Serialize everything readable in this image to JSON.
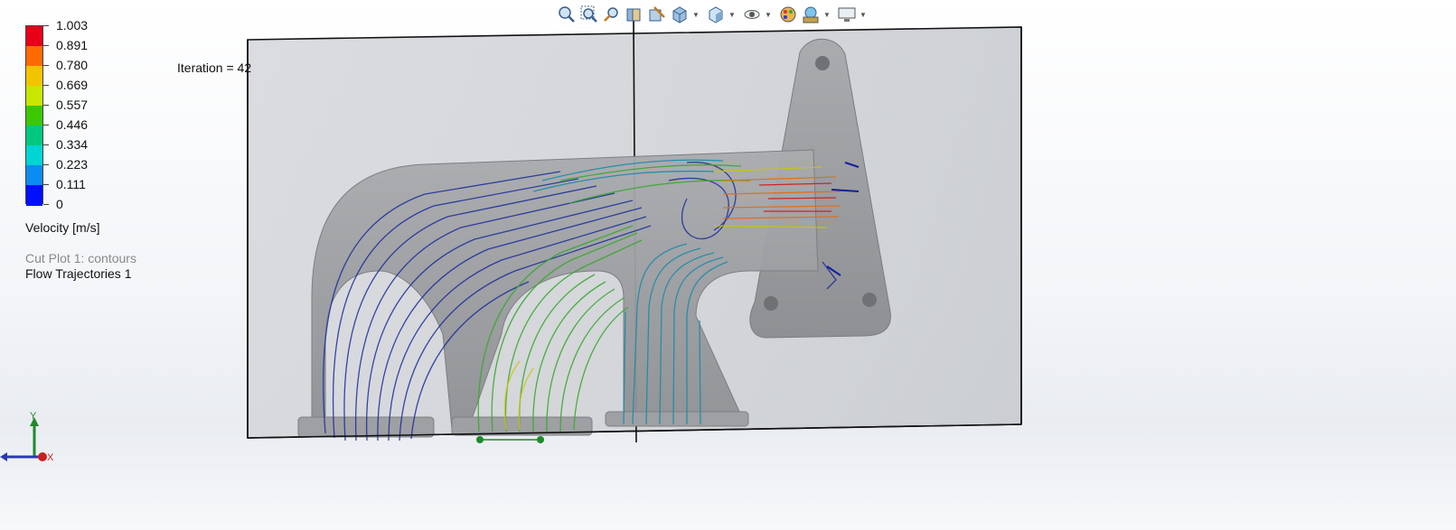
{
  "legend": {
    "ticks": [
      "1.003",
      "0.891",
      "0.780",
      "0.669",
      "0.557",
      "0.446",
      "0.334",
      "0.223",
      "0.111",
      "0"
    ],
    "colors": [
      "#e8001a",
      "#ff6a00",
      "#f2c400",
      "#c8e600",
      "#3cc800",
      "#00c880",
      "#00d4d4",
      "#0a8cf0",
      "#0010ff"
    ],
    "title": "Velocity [m/s]"
  },
  "plots": {
    "cut_plot": "Cut Plot 1: contours",
    "trajectories": "Flow Trajectories 1"
  },
  "iteration": "Iteration = 42",
  "toolbar": {
    "buttons": [
      {
        "icon": "zoom-to-fit-icon",
        "dropdown": false
      },
      {
        "icon": "zoom-to-area-icon",
        "dropdown": false
      },
      {
        "icon": "previous-view-icon",
        "dropdown": false
      },
      {
        "icon": "section-view-icon",
        "dropdown": false
      },
      {
        "icon": "dynamic-annotation-icon",
        "dropdown": false
      },
      {
        "icon": "view-orientation-icon",
        "dropdown": true
      },
      {
        "icon": "display-style-icon",
        "dropdown": true
      },
      {
        "icon": "hide-show-items-icon",
        "dropdown": true
      },
      {
        "icon": "edit-appearance-icon",
        "dropdown": false
      },
      {
        "icon": "apply-scene-icon",
        "dropdown": true
      },
      {
        "icon": "view-settings-icon",
        "dropdown": true
      }
    ]
  },
  "triad": {
    "y": "Y",
    "x": "X"
  }
}
